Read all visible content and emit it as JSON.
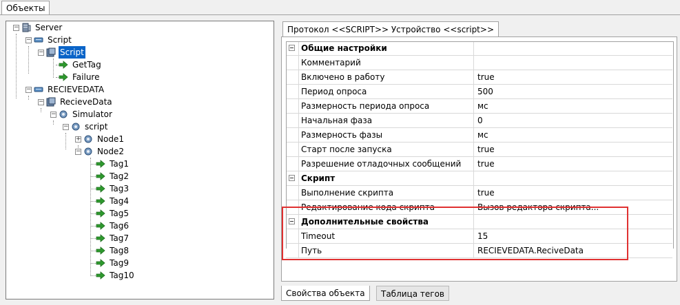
{
  "top_tab": {
    "label": "Объекты"
  },
  "tree": {
    "server": "Server",
    "script_group": "Script",
    "script_item": "Script",
    "gettag": "GetTag",
    "failure": "Failure",
    "recievedata": "RECIEVEDATA",
    "recievedata_item": "RecieveData",
    "simulator": "Simulator",
    "script_node": "script",
    "node1": "Node1",
    "node2": "Node2",
    "tags": [
      "Tag1",
      "Tag2",
      "Tag3",
      "Tag4",
      "Tag5",
      "Tag6",
      "Tag7",
      "Tag8",
      "Tag9",
      "Tag10"
    ]
  },
  "protocol_tab": {
    "label": "Протокол <<SCRIPT>> Устройство <<script>>"
  },
  "properties": {
    "rows": [
      {
        "name": "Общие настройки",
        "value": "",
        "category": true
      },
      {
        "name": "Комментарий",
        "value": ""
      },
      {
        "name": "Включено в работу",
        "value": "true"
      },
      {
        "name": "Период опроса",
        "value": "500"
      },
      {
        "name": "Размерность периода опроса",
        "value": "мс"
      },
      {
        "name": "Начальная фаза",
        "value": "0"
      },
      {
        "name": "Размерность фазы",
        "value": "мс"
      },
      {
        "name": "Старт после запуска",
        "value": "true"
      },
      {
        "name": "Разрешение отладочных сообщений",
        "value": "true"
      },
      {
        "name": "Скрипт",
        "value": "",
        "category": true
      },
      {
        "name": "Выполнение скрипта",
        "value": "true"
      },
      {
        "name": "Редактирование кода скрипта",
        "value": "Вызов редактора скрипта..."
      },
      {
        "name": "Дополнительные свойства",
        "value": "",
        "category": true
      },
      {
        "name": "Timeout",
        "value": "15"
      },
      {
        "name": "Путь",
        "value": "RECIEVEDATA.ReciveData"
      }
    ]
  },
  "bottom_tabs": {
    "object_props": "Свойства объекта",
    "tag_table": "Таблица тегов"
  },
  "colors": {
    "selection": "#0a64c8",
    "highlight_box": "#e03030",
    "tag_arrow": "#2e9a2e"
  }
}
